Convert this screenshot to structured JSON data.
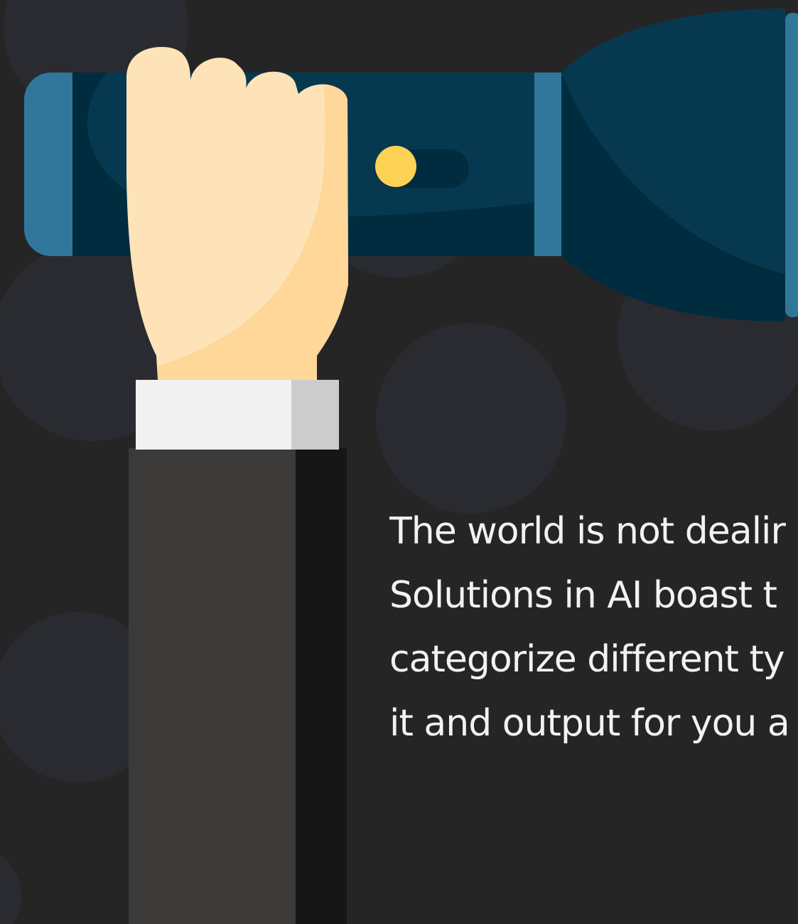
{
  "colors": {
    "background": "#252526",
    "circle": "#2a2b30",
    "flashlight_body": "#06394f",
    "flashlight_accent": "#31779c",
    "flashlight_dark": "#002c3f",
    "switch_light": "#fdd153",
    "hand": "#ffe3b8",
    "hand_shade": "#fed799",
    "cuff": "#f1f1f1",
    "cuff_shade": "#cccccc",
    "sleeve": "#3b3a38",
    "sleeve_shade": "#161616",
    "text": "#f2f2f2"
  },
  "text_lines": [
    "The world is not dealir",
    "Solutions in AI boast t",
    "categorize different ty",
    "it and output for you a"
  ]
}
